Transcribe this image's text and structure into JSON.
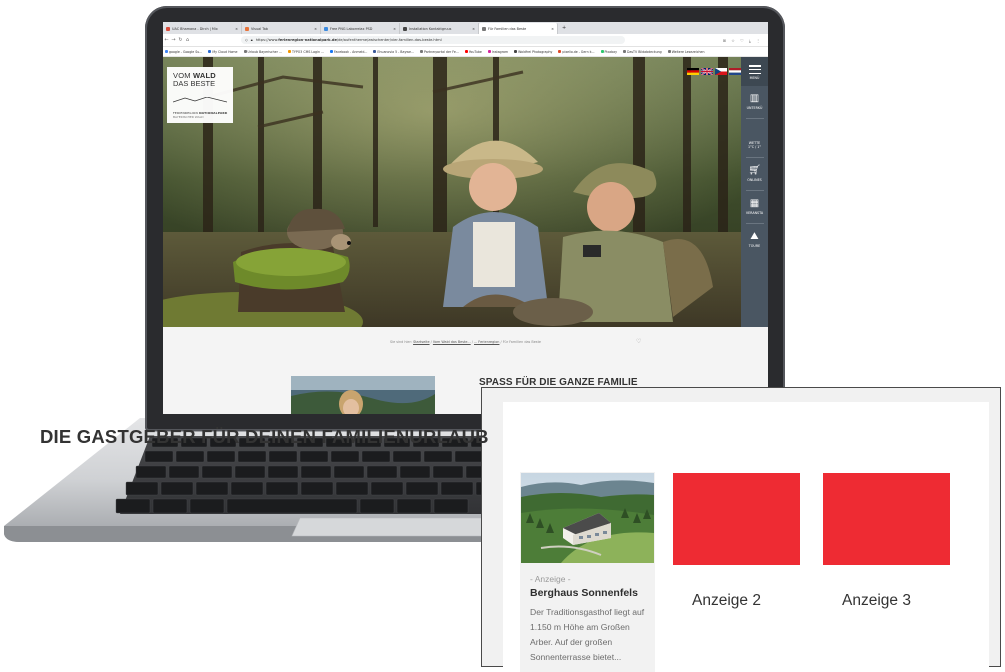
{
  "browser": {
    "tabs": [
      {
        "label": "UAC Bhamana - Dirch | Mix ",
        "active": false
      },
      {
        "label": "Visual Tab",
        "active": false
      },
      {
        "label": "Free PNG Laborrelax PSD ",
        "active": false
      },
      {
        "label": "Installation Kontaktgruus ",
        "active": false
      },
      {
        "label": "Für Familien das Beste",
        "active": true
      }
    ],
    "new_tab": "+",
    "url_prefix": "https://www.",
    "url_host": "ferienregion-nationalpark.de",
    "url_path": "/de/aufentherme/zwischenter/vier-familien-das-beste.html",
    "bookmarks": [
      {
        "label": "google - Google Su...",
        "color": "#4285f4"
      },
      {
        "label": "My Cloud Home",
        "color": "#2a6bd4"
      },
      {
        "label": "Urlaub Bayerischer ...",
        "color": "#777777"
      },
      {
        "label": "TYPO3 CMS Login ...",
        "color": "#f49700"
      },
      {
        "label": "Facebook - Anmeld...",
        "color": "#1877f2"
      },
      {
        "label": "Ehuanovia 5 - Baywe...",
        "color": "#3b5998"
      },
      {
        "label": "Partnerportal der Fe...",
        "color": "#777777"
      },
      {
        "label": "YouTube",
        "color": "#ff0000"
      },
      {
        "label": "Instagram",
        "color": "#d6249f"
      },
      {
        "label": "Waldfrei Photography",
        "color": "#444444"
      },
      {
        "label": "pixelio.de - Gern k...",
        "color": "#e04a2a"
      },
      {
        "label": "Pixabay",
        "color": "#2ec66d"
      },
      {
        "label": "DasTV Bildabdeckung",
        "color": "#777777"
      },
      {
        "label": "Weitere Lesezeichen",
        "color": "#777777"
      }
    ]
  },
  "site": {
    "logo": {
      "line1_a": "VOM ",
      "line1_b": "WALD",
      "line2": "DAS BESTE",
      "line3_a": "FERIENREGION ",
      "line3_b": "NATIONALPARK",
      "line4": "BAYERISCHER WALD"
    },
    "sidebar": [
      {
        "label": "MENÜ",
        "icon": "menu-icon"
      },
      {
        "label": "UNTERKÜ",
        "icon": "hotel-icon"
      },
      {
        "label": "WETTE\n1°C / 1°",
        "icon": "weather-icon"
      },
      {
        "label": "ONLINES",
        "icon": "cart-icon"
      },
      {
        "label": "VERANSTA",
        "icon": "calendar-icon"
      },
      {
        "label": "TOURE",
        "icon": "hiker-icon"
      }
    ],
    "breadcrumb": {
      "prefix": "Sie sind hier:",
      "items": [
        "Startseite",
        "Vom Wald das Beste...",
        "... Ferienregion",
        "Für Familien das Beste"
      ]
    },
    "section_title": "SPASS FÜR DIE GANZE FAMILIE"
  },
  "card": {
    "title": "DIE GASTGEBER FÜR DEINEN FAMILIENURLAUB",
    "host1": {
      "tag": "- Anzeige -",
      "name": "Berghaus Sonnenfels",
      "desc": "Der Traditionsgasthof liegt auf 1.150 m Höhe am Großen Arber. Auf der großen Sonnenterrasse bietet..."
    },
    "ad2": "Anzeige 2",
    "ad3": "Anzeige 3",
    "ad_color": "#ee2b33"
  }
}
